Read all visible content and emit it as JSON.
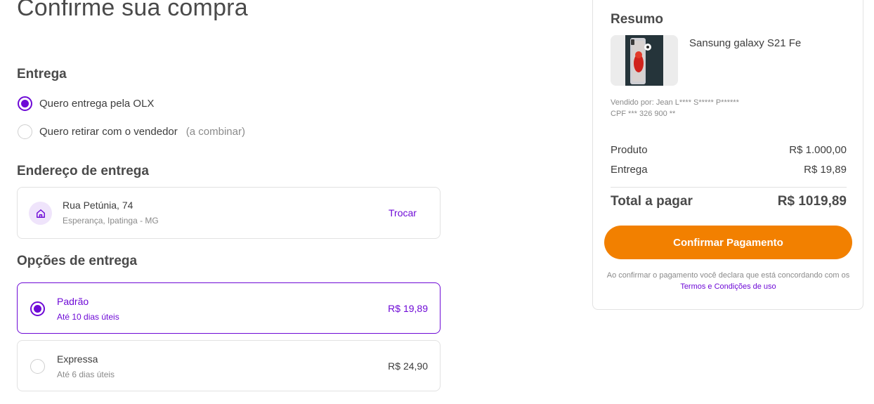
{
  "page": {
    "title": "Confirme sua compra"
  },
  "delivery": {
    "title": "Entrega",
    "options": [
      {
        "label": "Quero entrega pela OLX",
        "note": "",
        "checked": true
      },
      {
        "label": "Quero retirar com o vendedor",
        "note": "(a combinar)",
        "checked": false
      }
    ]
  },
  "address": {
    "title": "Endereço de entrega",
    "icon": "home-icon",
    "line1": "Rua Petúnia, 74",
    "line2": "Esperança, Ipatinga - MG",
    "change_label": "Trocar"
  },
  "shipping": {
    "title": "Opções de entrega",
    "options": [
      {
        "name": "Padrão",
        "eta": "Até 10 dias úteis",
        "price": "R$ 19,89",
        "selected": true
      },
      {
        "name": "Expressa",
        "eta": "Até 6 dias úteis",
        "price": "R$ 24,90",
        "selected": false
      }
    ]
  },
  "summary": {
    "title": "Resumo",
    "product_name": "Sansung galaxy S21 Fe",
    "seller_line": "Vendido por: Jean L**** S***** P******",
    "cpf_line": "CPF *** 326 900 **",
    "product_label": "Produto",
    "product_value": "R$ 1.000,00",
    "delivery_label": "Entrega",
    "delivery_value": "R$ 19,89",
    "total_label": "Total a pagar",
    "total_value": "R$ 1019,89",
    "confirm_label": "Confirmar Pagamento",
    "disclaimer_text": "Ao confirmar o pagamento você declara que está concordando com os",
    "terms_label": "Termos e Condições de uso"
  },
  "colors": {
    "accent": "#6e0ad6",
    "cta": "#f28000"
  }
}
